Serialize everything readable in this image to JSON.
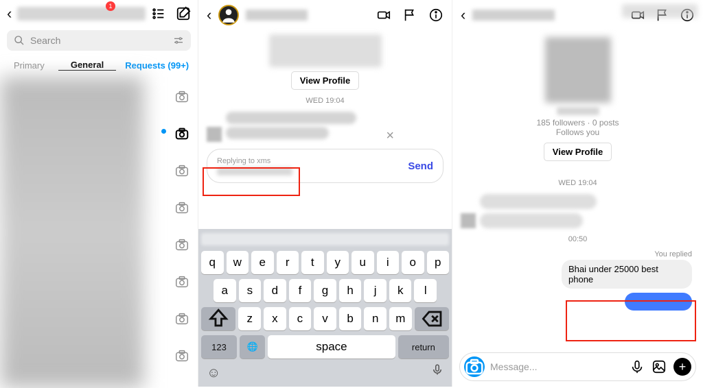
{
  "panel1": {
    "notify_count": "1",
    "search_placeholder": "Search",
    "tabs": {
      "primary": "Primary",
      "general": "General",
      "requests": "Requests (99+)"
    }
  },
  "panel2": {
    "view_profile": "View Profile",
    "timestamp": "WED 19:04",
    "replying_label": "Replying to xms",
    "send": "Send",
    "keyboard": {
      "row1": [
        "q",
        "w",
        "e",
        "r",
        "t",
        "y",
        "u",
        "i",
        "o",
        "p"
      ],
      "row2": [
        "a",
        "s",
        "d",
        "f",
        "g",
        "h",
        "j",
        "k",
        "l"
      ],
      "row3": [
        "z",
        "x",
        "c",
        "v",
        "b",
        "n",
        "m"
      ],
      "num": "123",
      "space": "space",
      "return": "return"
    }
  },
  "panel3": {
    "stats": "185 followers · 0 posts",
    "follows": "Follows you",
    "view_profile": "View Profile",
    "timestamp": "WED 19:04",
    "time2": "00:50",
    "you_replied": "You replied",
    "reply_text": "Bhai under 25000 best phone",
    "msg_placeholder": "Message..."
  }
}
